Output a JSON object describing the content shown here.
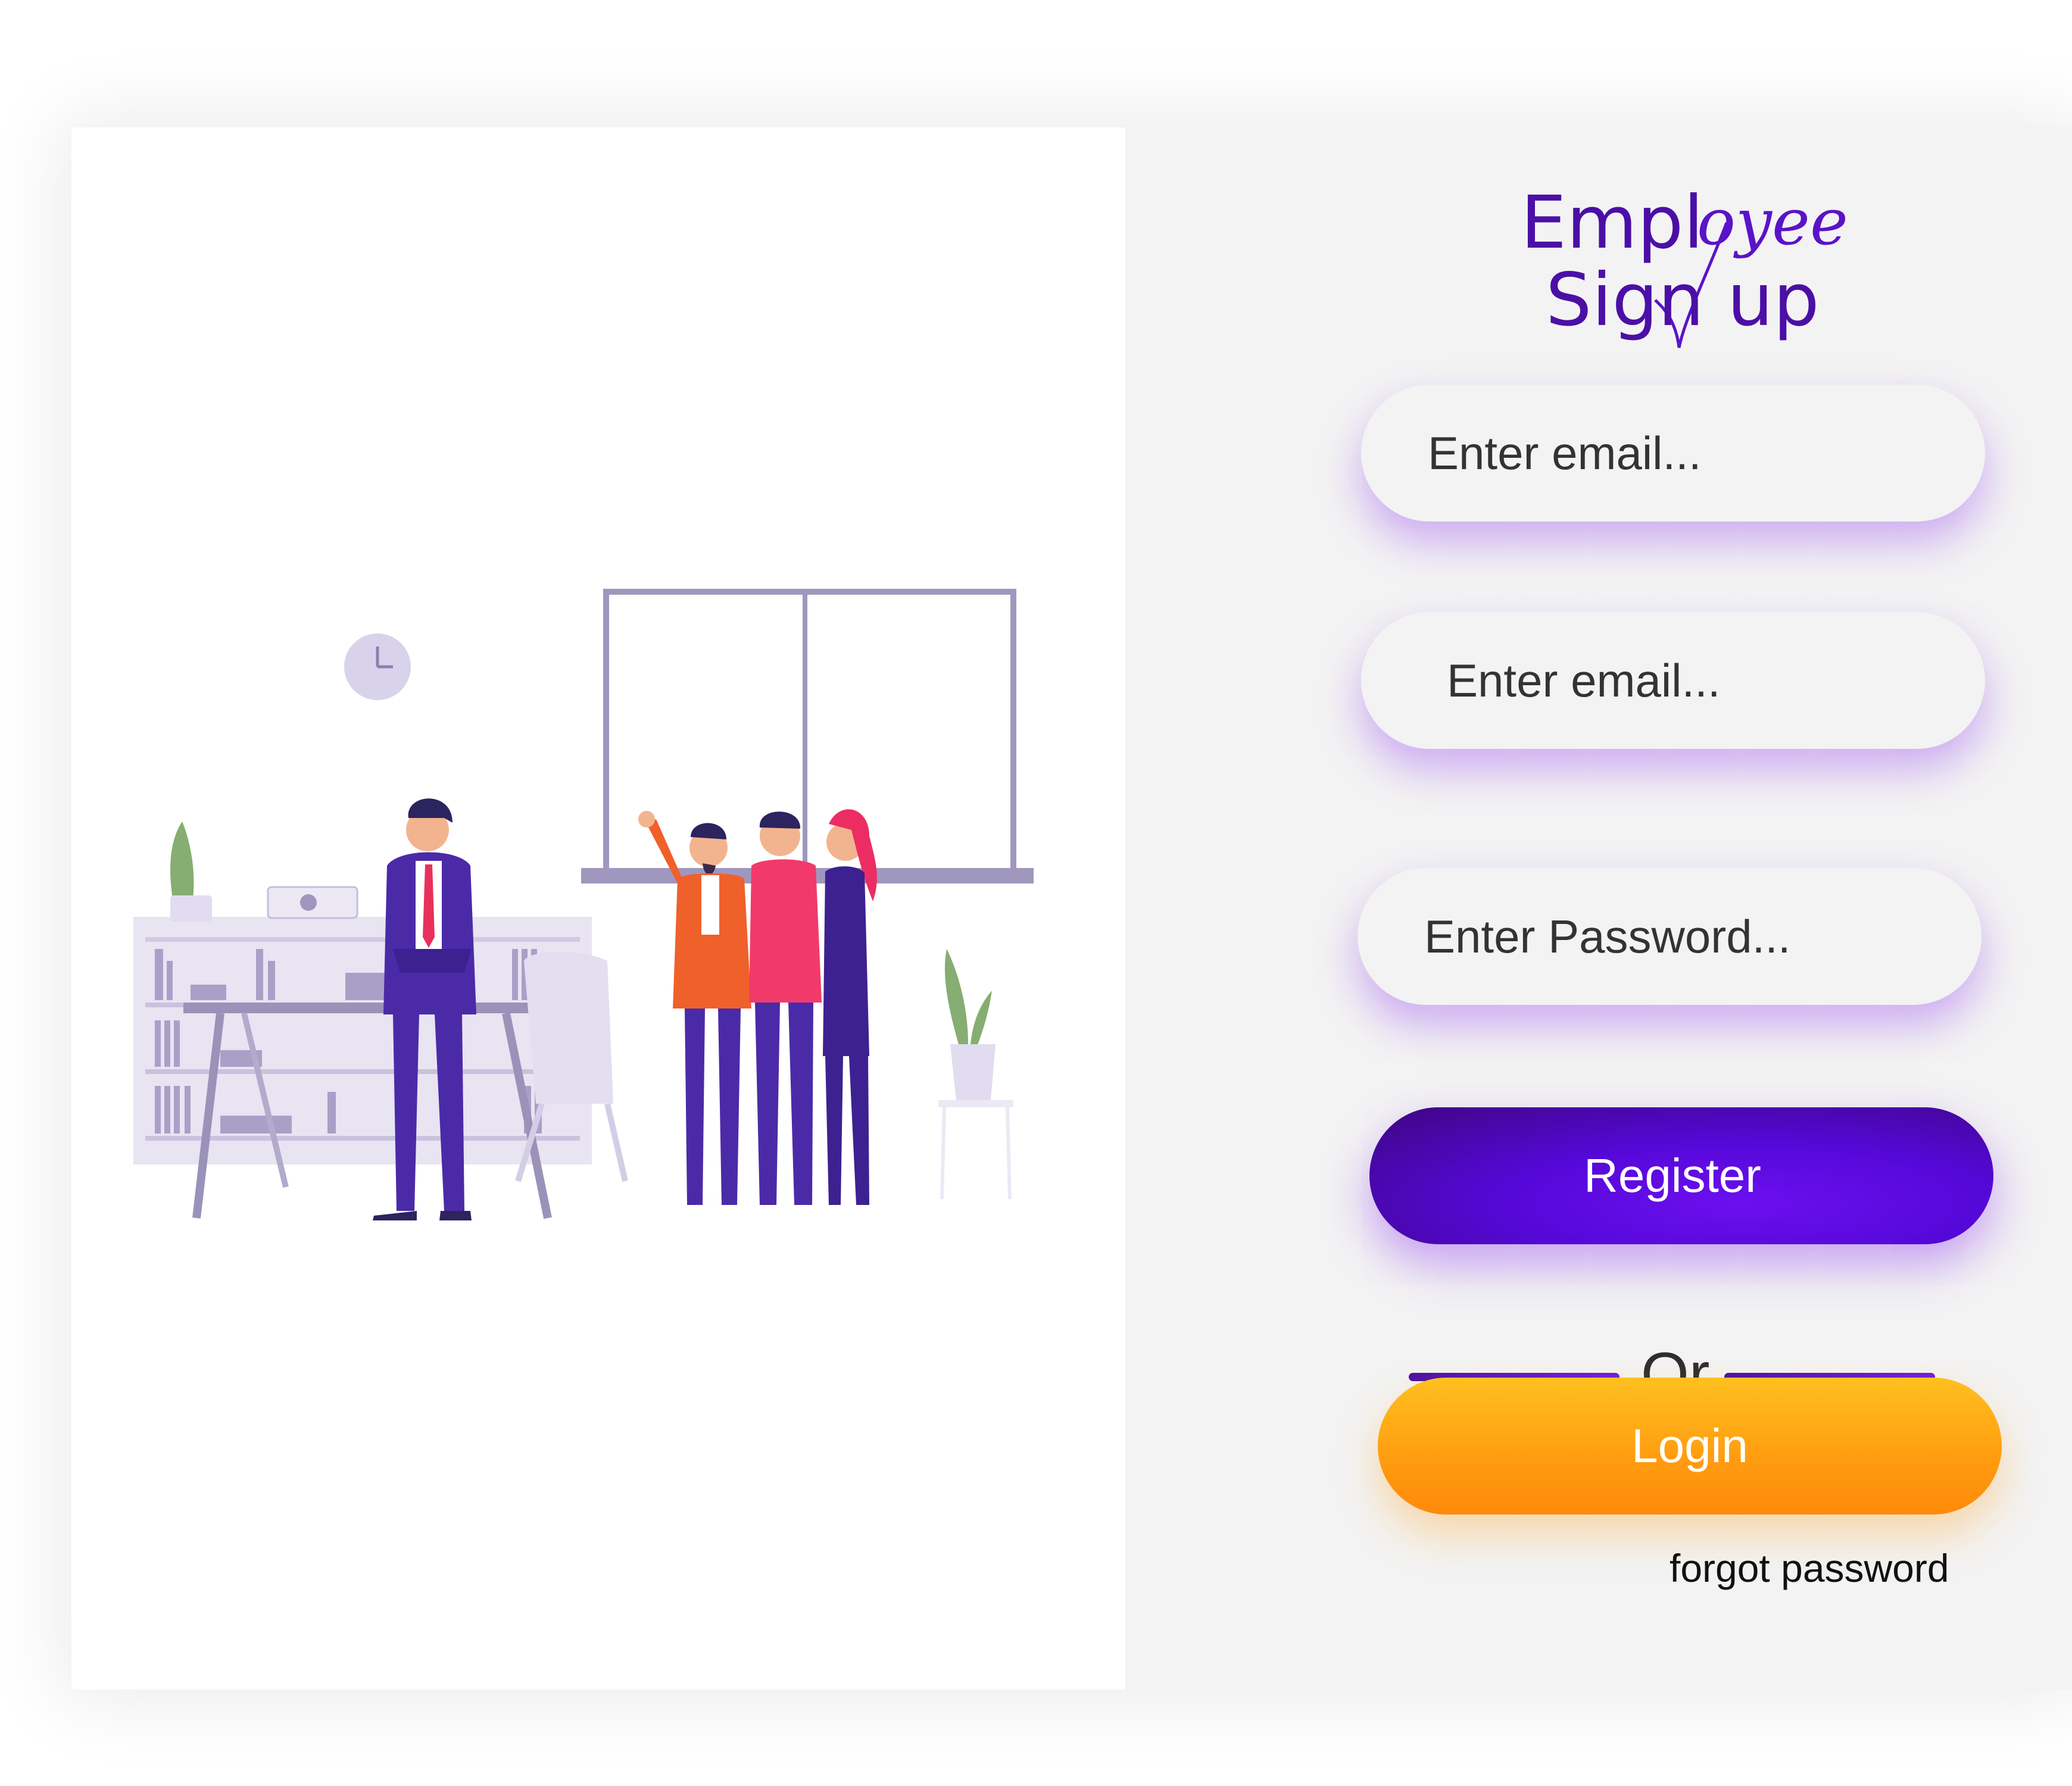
{
  "title": {
    "line1_prefix": "Empl",
    "line1_script": "oyee",
    "line2": "Sign up"
  },
  "form": {
    "email1_placeholder": "Enter email...",
    "email2_placeholder": "Enter email...",
    "password_placeholder": "Enter Password..."
  },
  "actions": {
    "register_label": "Register",
    "separator_label": "Or",
    "login_label": "Login",
    "forgot_label": "forgot password"
  },
  "colors": {
    "accent_purple": "#5508d8",
    "title_purple": "#4b0fa6",
    "login_orange": "#ff9c10",
    "panel_bg": "#f3f3f3"
  }
}
